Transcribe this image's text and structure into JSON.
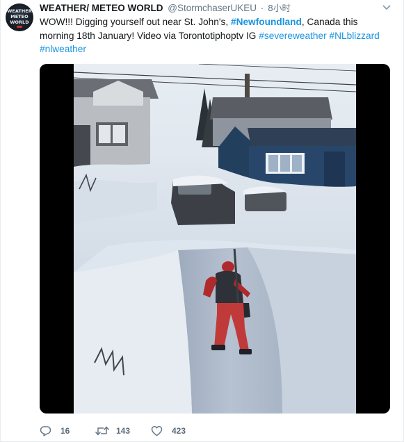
{
  "tweet": {
    "avatar": {
      "line1": "WEATHER",
      "line2": "METEO",
      "line3": "WORLD"
    },
    "display_name": "WEATHER/ METEO WORLD",
    "handle": "@StormchaserUKEU",
    "separator": "·",
    "time": "8小时",
    "text": {
      "part1": "WOW!!! Digging yourself out near St. John's, ",
      "hashtag_newfoundland": "#Newfoundland",
      "part2": ", Canada this morning 18th January! Video via Torontotiphoptv IG ",
      "hashtag_severeweather": "#severeweather",
      "space": " ",
      "hashtag_nlblizzard": "#NLblizzard",
      "hashtag_nlweather": "#nlweather"
    },
    "actions": {
      "replies": "16",
      "retweets": "143",
      "likes": "423"
    }
  },
  "icons": {
    "reply": "reply-bubble-icon",
    "retweet": "retweet-icon",
    "like": "heart-icon",
    "caret": "chevron-down-icon"
  },
  "colors": {
    "link": "#1b95e0",
    "muted": "#657786",
    "text": "#14171a"
  }
}
